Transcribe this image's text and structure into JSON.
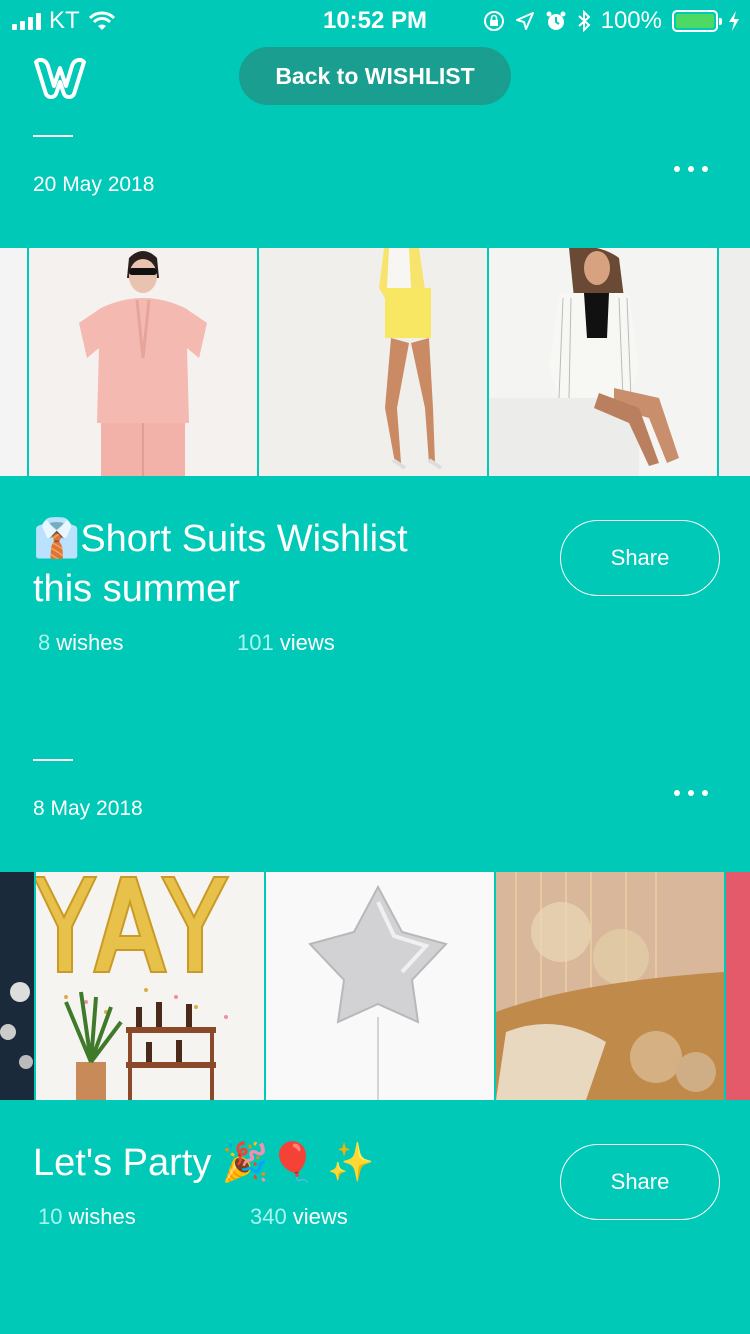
{
  "status_bar": {
    "carrier": "KT",
    "time": "10:52 PM",
    "battery": "100%",
    "icons": [
      "signal-icon",
      "wifi-icon",
      "rotation-lock-icon",
      "location-icon",
      "alarm-icon",
      "bluetooth-icon",
      "battery-icon",
      "charging-icon"
    ]
  },
  "header": {
    "logo": "wishlist-logo",
    "back_label": "Back to WISHLIST"
  },
  "colors": {
    "background": "#00c9b7",
    "back_button": "#1a9e8f",
    "stat_number": "#a8f5ec"
  },
  "wishlists": [
    {
      "date": "20 May 2018",
      "title_emoji": "👔",
      "title": "Short Suits Wishlist this summer",
      "wishes_count": "8",
      "wishes_label": "wishes",
      "views_count": "101",
      "views_label": "views",
      "share_label": "Share",
      "images": [
        "pink-short-suit-image",
        "yellow-short-suit-image",
        "white-striped-short-suit-image"
      ]
    },
    {
      "date": "8 May 2018",
      "title": "Let's Party 🎉🎈 ✨",
      "wishes_count": "10",
      "wishes_label": "wishes",
      "views_count": "340",
      "views_label": "views",
      "share_label": "Share",
      "images": [
        "yay-balloons-image",
        "silver-star-balloon-image",
        "fairy-lights-balloons-image"
      ]
    }
  ]
}
